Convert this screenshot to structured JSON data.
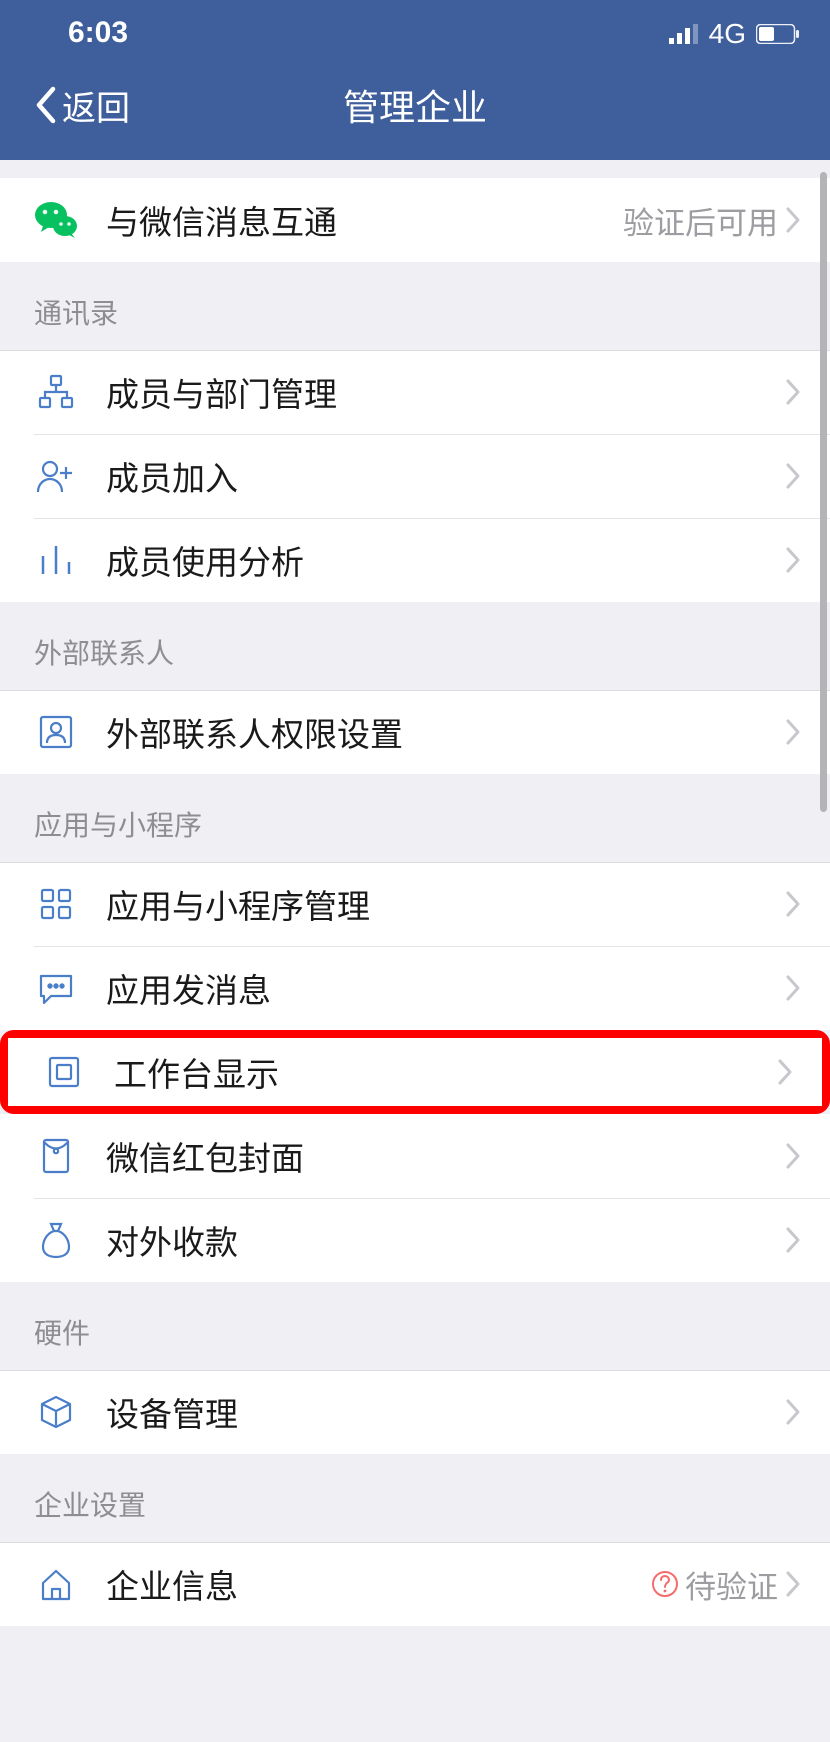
{
  "status": {
    "time": "6:03",
    "network": "4G"
  },
  "header": {
    "back": "返回",
    "title": "管理企业"
  },
  "sections": {
    "top": {
      "wechat_interop": {
        "label": "与微信消息互通",
        "value": "验证后可用"
      }
    },
    "contacts": {
      "header": "通讯录",
      "members_dept": "成员与部门管理",
      "member_join": "成员加入",
      "usage_analysis": "成员使用分析"
    },
    "external": {
      "header": "外部联系人",
      "permission": "外部联系人权限设置"
    },
    "apps": {
      "header": "应用与小程序",
      "manage": "应用与小程序管理",
      "send_msg": "应用发消息",
      "workspace_display": "工作台显示",
      "redpacket_cover": "微信红包封面",
      "external_payment": "对外收款"
    },
    "hardware": {
      "header": "硬件",
      "device_manage": "设备管理"
    },
    "enterprise": {
      "header": "企业设置",
      "info": {
        "label": "企业信息",
        "value": "待验证"
      }
    }
  }
}
